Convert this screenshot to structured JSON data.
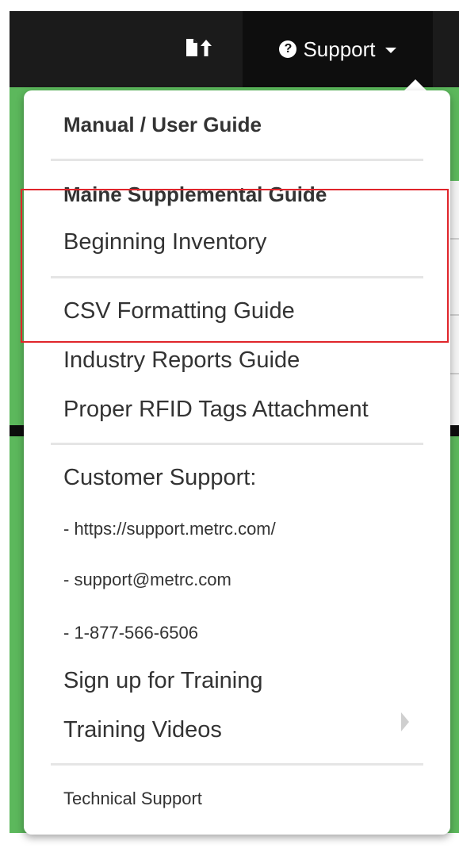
{
  "navbar": {
    "support_label": "Support",
    "upload_icon": "file-upload-icon",
    "help_icon": "question-circle-icon",
    "caret_icon": "caret-down-icon"
  },
  "menu": {
    "manual": "Manual / User Guide",
    "maine_guide": "Maine Supplemental Guide",
    "beginning_inventory": "Beginning Inventory",
    "csv_guide": "CSV Formatting Guide",
    "industry_reports": "Industry Reports Guide",
    "rfid": "Proper RFID Tags Attachment",
    "customer_support": "Customer Support:",
    "support_url": "- https://support.metrc.com/",
    "support_email": "- support@metrc.com",
    "support_phone": "- 1-877-566-6506",
    "training_signup": "Sign up for Training",
    "training_videos": "Training Videos",
    "technical_support": "Technical Support"
  },
  "colors": {
    "navbar": "#1b1b1b",
    "background_green": "#5cb85c",
    "highlight": "#e0252b"
  }
}
